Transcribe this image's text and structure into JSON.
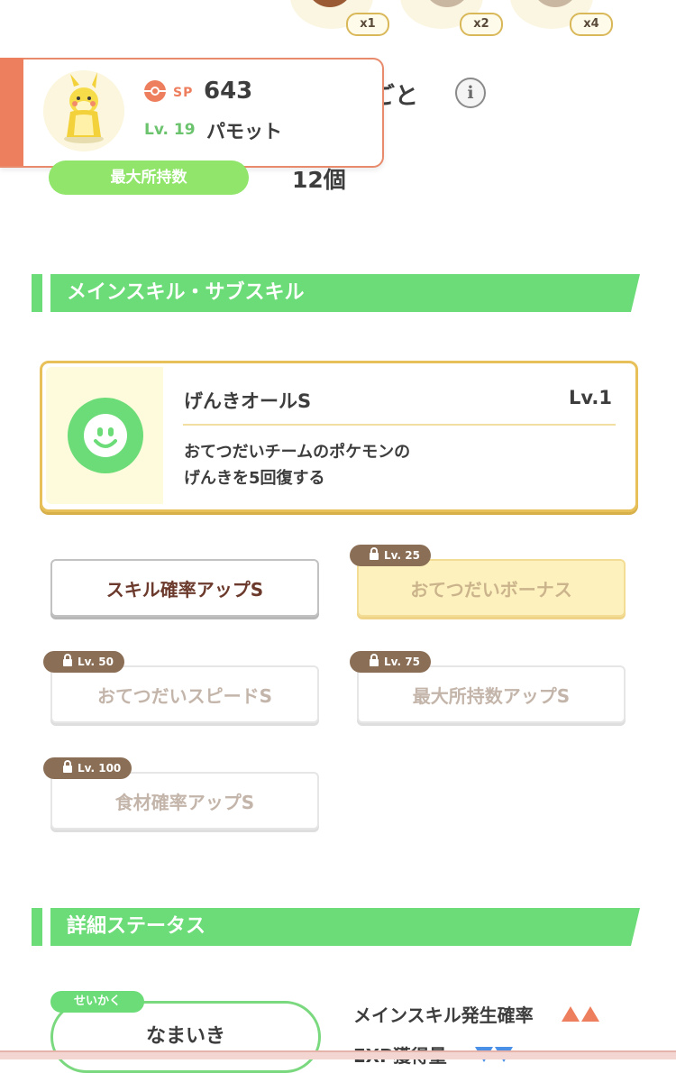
{
  "ingredients": [
    {
      "qty": "x1"
    },
    {
      "qty": "x2"
    },
    {
      "qty": "x4"
    }
  ],
  "header": {
    "sp_label": "SP",
    "sp_value": "643",
    "level": "Lv. 19",
    "pokemon_name": "パモット",
    "behind_title": "ごと"
  },
  "capacity": {
    "label": "最大所持数",
    "value": "12個"
  },
  "skills_section": {
    "title": "メインスキル・サブスキル",
    "main_skill": {
      "name": "げんきオールS",
      "level": "Lv.1",
      "desc_line1": "おてつだいチームのポケモンの",
      "desc_line2": "げんきを5回復する"
    },
    "sub_skills": [
      {
        "label": "スキル確率アップS",
        "lock": ""
      },
      {
        "label": "おてつだいボーナス",
        "lock": "Lv. 25"
      },
      {
        "label": "おてつだいスピードS",
        "lock": "Lv. 50"
      },
      {
        "label": "最大所持数アップS",
        "lock": "Lv. 75"
      },
      {
        "label": "食材確率アップS",
        "lock": "Lv. 100"
      }
    ]
  },
  "status_section": {
    "title": "詳細ステータス",
    "nature_label": "せいかく",
    "nature_value": "なまいき",
    "stats": [
      {
        "label": "メインスキル発生確率",
        "trend": "up"
      },
      {
        "label": "EXP獲得量",
        "trend": "down"
      }
    ]
  },
  "colors": {
    "accent_green": "#6cdc78",
    "accent_orange": "#ee7f5e",
    "gold": "#e8c05a",
    "lock_brown": "#8a6e55"
  }
}
